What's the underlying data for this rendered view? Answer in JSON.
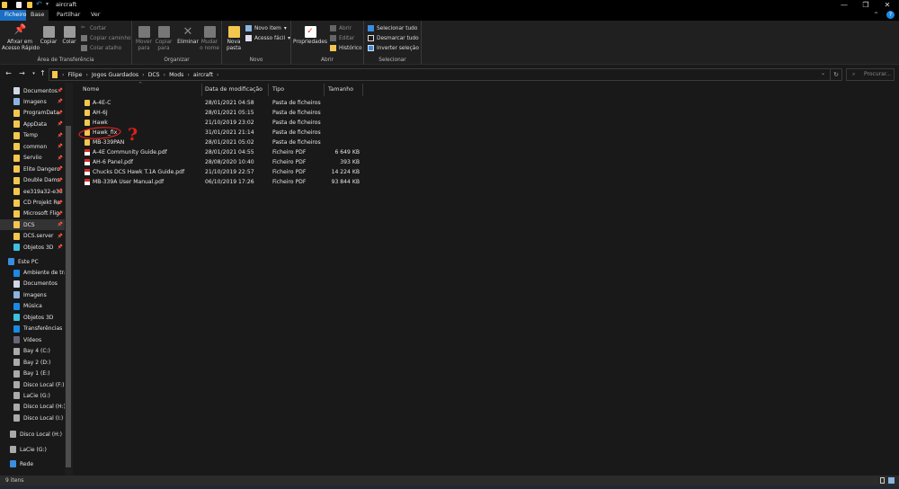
{
  "window": {
    "title": "aircraft",
    "minimize": "—",
    "restore": "❐",
    "close": "✕"
  },
  "tabs": [
    {
      "label": "Ficheiro"
    },
    {
      "label": "Base"
    },
    {
      "label": "Partilhar"
    },
    {
      "label": "Ver"
    }
  ],
  "ribbon": {
    "clipboard": {
      "label": "Área de Transferência",
      "pin": "Afixar em\nAcesso Rápido",
      "copy": "Copiar",
      "paste": "Colar",
      "cut": "Cortar",
      "copy_path": "Copiar caminho",
      "paste_shortcut": "Colar atalho"
    },
    "organize": {
      "label": "Organizar",
      "move": "Mover\npara",
      "copy_to": "Copiar\npara",
      "delete": "Eliminar",
      "rename": "Mudar\no nome"
    },
    "new": {
      "label": "Novo",
      "new_folder": "Nova\npasta",
      "new_item": "Novo item",
      "easy_access": "Acesso fácil"
    },
    "open": {
      "label": "Abrir",
      "properties": "Propriedades",
      "open": "Abrir",
      "edit": "Editar",
      "history": "Histórico"
    },
    "select": {
      "label": "Selecionar",
      "select_all": "Selecionar tudo",
      "select_none": "Desmarcar tudo",
      "invert": "Inverter seleção"
    }
  },
  "address": {
    "crumbs": [
      "Filipe",
      "Jogos Guardados",
      "DCS",
      "Mods",
      "aircraft"
    ],
    "search_placeholder": "Procurar..."
  },
  "navpane": {
    "quick_access": [
      {
        "label": "Documentos",
        "icon": "document-icon"
      },
      {
        "label": "Imagens",
        "icon": "pictures-icon"
      },
      {
        "label": "ProgramData",
        "icon": "folder-icon"
      },
      {
        "label": "AppData",
        "icon": "folder-icon"
      },
      {
        "label": "Temp",
        "icon": "folder-icon"
      },
      {
        "label": "common",
        "icon": "folder-icon"
      },
      {
        "label": "Serviio",
        "icon": "folder-icon"
      },
      {
        "label": "Elite Dangero",
        "icon": "folder-icon"
      },
      {
        "label": "Double Dams",
        "icon": "folder-icon"
      },
      {
        "label": "ee319a32-e3e",
        "icon": "folder-icon"
      },
      {
        "label": "CD Projekt Re",
        "icon": "folder-icon"
      },
      {
        "label": "Microsoft Flig",
        "icon": "folder-icon"
      },
      {
        "label": "DCS",
        "icon": "folder-icon",
        "selected": true
      },
      {
        "label": "DCS.server",
        "icon": "folder-icon"
      },
      {
        "label": "Objetos 3D",
        "icon": "3d-objects-icon"
      }
    ],
    "this_pc": {
      "label": "Este PC",
      "items": [
        {
          "label": "Ambiente de tra",
          "icon": "desktop-icon"
        },
        {
          "label": "Documentos",
          "icon": "document-icon"
        },
        {
          "label": "Imagens",
          "icon": "pictures-icon"
        },
        {
          "label": "Música",
          "icon": "music-icon"
        },
        {
          "label": "Objetos 3D",
          "icon": "3d-objects-icon"
        },
        {
          "label": "Transferências",
          "icon": "download-icon"
        },
        {
          "label": "Vídeos",
          "icon": "video-icon"
        },
        {
          "label": "Bay 4 (C:)",
          "icon": "drive-icon"
        },
        {
          "label": "Bay 2 (D:)",
          "icon": "drive-icon"
        },
        {
          "label": "Bay 1 (E:)",
          "icon": "drive-icon"
        },
        {
          "label": "Disco Local (F:)",
          "icon": "drive-icon"
        },
        {
          "label": "LaCie (G:)",
          "icon": "drive-icon"
        },
        {
          "label": "Disco Local (H:)",
          "icon": "drive-icon"
        },
        {
          "label": "Disco Local (I:)",
          "icon": "drive-icon"
        }
      ]
    },
    "extra": [
      {
        "label": "Disco Local (H:)",
        "icon": "drive-icon"
      },
      {
        "label": "LaCie (G:)",
        "icon": "drive-icon"
      },
      {
        "label": "Rede",
        "icon": "network-icon"
      }
    ]
  },
  "columns": {
    "name": "Nome",
    "date": "Data de modificação",
    "type": "Tipo",
    "size": "Tamanho"
  },
  "files": [
    {
      "name": "A-4E-C",
      "date": "28/01/2021 04:58",
      "type": "Pasta de ficheiros",
      "size": "",
      "kind": "folder"
    },
    {
      "name": "AH-6J",
      "date": "28/01/2021 05:15",
      "type": "Pasta de ficheiros",
      "size": "",
      "kind": "folder"
    },
    {
      "name": "Hawk",
      "date": "21/10/2019 23:02",
      "type": "Pasta de ficheiros",
      "size": "",
      "kind": "folder"
    },
    {
      "name": "Hawk_fix",
      "date": "31/01/2021 21:14",
      "type": "Pasta de ficheiros",
      "size": "",
      "kind": "folder"
    },
    {
      "name": "MB-339PAN",
      "date": "28/01/2021 05:02",
      "type": "Pasta de ficheiros",
      "size": "",
      "kind": "folder"
    },
    {
      "name": "A-4E Community Guide.pdf",
      "date": "28/01/2021 04:55",
      "type": "Ficheiro PDF",
      "size": "6 649 KB",
      "kind": "pdf"
    },
    {
      "name": "AH-6 Panel.pdf",
      "date": "28/08/2020 10:40",
      "type": "Ficheiro PDF",
      "size": "393 KB",
      "kind": "pdf"
    },
    {
      "name": "Chucks DCS Hawk T.1A Guide.pdf",
      "date": "21/10/2019 22:57",
      "type": "Ficheiro PDF",
      "size": "14 224 KB",
      "kind": "pdf"
    },
    {
      "name": "MB-339A User Manual.pdf",
      "date": "06/10/2019 17:26",
      "type": "Ficheiro PDF",
      "size": "93 844 KB",
      "kind": "pdf"
    }
  ],
  "annotation": {
    "mark": "?",
    "color": "#e0201c"
  },
  "status": {
    "count": "9 itens"
  },
  "colors": {
    "accent": "#1a6fc4",
    "folder": "#f3c74e",
    "pdf": "#d42a2a"
  }
}
